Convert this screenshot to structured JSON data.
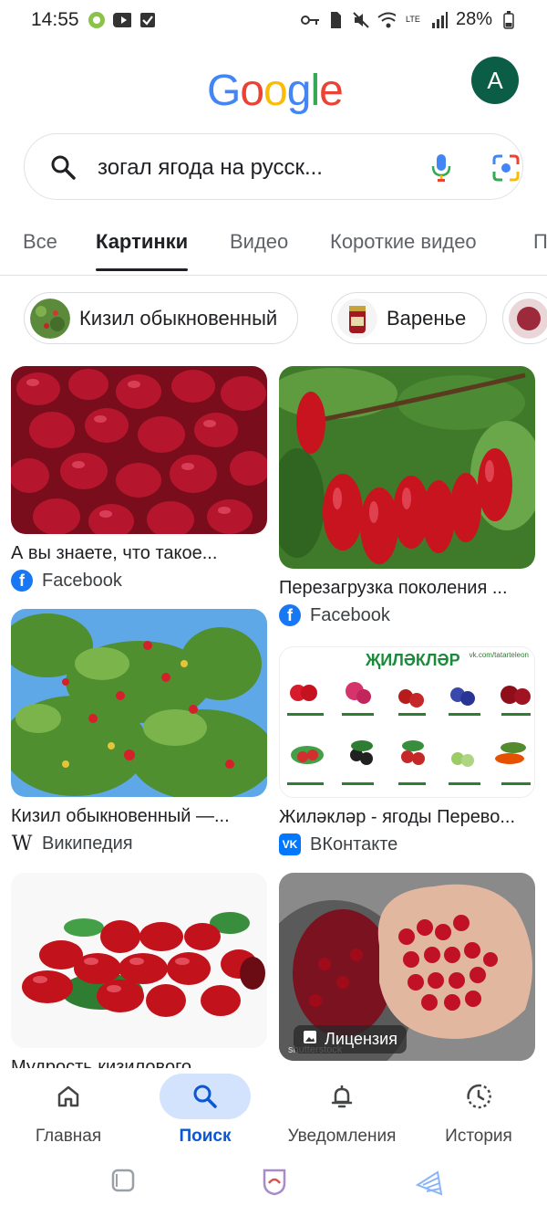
{
  "status_bar": {
    "time": "14:55",
    "battery": "28%",
    "network": "LTE"
  },
  "header": {
    "logo_letters": [
      "G",
      "o",
      "o",
      "g",
      "l",
      "e"
    ],
    "avatar_letter": "A"
  },
  "search": {
    "query": "зогал ягода на русск..."
  },
  "tabs": [
    {
      "label": "Все"
    },
    {
      "label": "Картинки"
    },
    {
      "label": "Видео"
    },
    {
      "label": "Короткие видео"
    },
    {
      "label": "П"
    }
  ],
  "chips": [
    {
      "label": "Кизил обыкновенный"
    },
    {
      "label": "Варенье"
    }
  ],
  "results": [
    {
      "title": "А вы знаете, что такое...",
      "source": "Facebook",
      "source_icon": "facebook-icon"
    },
    {
      "title": "Перезагрузка поколения ...",
      "source": "Facebook",
      "source_icon": "facebook-icon"
    },
    {
      "title": "Кизил обыкновенный —...",
      "source": "Википедия",
      "source_icon": "wikipedia-icon"
    },
    {
      "title": "Жиләкләр - ягоды Перево...",
      "source": "ВКонтакте",
      "source_icon": "vk-icon",
      "image_heading": "ҖИЛӘКЛӘР",
      "image_site": "vk.com/tatarteleon"
    },
    {
      "title": "Мудрость кизилового",
      "source": "",
      "source_icon": ""
    },
    {
      "title": "",
      "source": "",
      "license": "Лицензия",
      "watermark": "shutterstock"
    }
  ],
  "bottom_nav": [
    {
      "label": "Главная",
      "icon": "home-icon"
    },
    {
      "label": "Поиск",
      "icon": "search-icon"
    },
    {
      "label": "Уведомления",
      "icon": "bell-icon"
    },
    {
      "label": "История",
      "icon": "history-icon"
    }
  ],
  "colors": {
    "accent": "#0b57d0",
    "avatar_bg": "#0b5e45",
    "nav_active_bg": "#d3e3fd"
  }
}
